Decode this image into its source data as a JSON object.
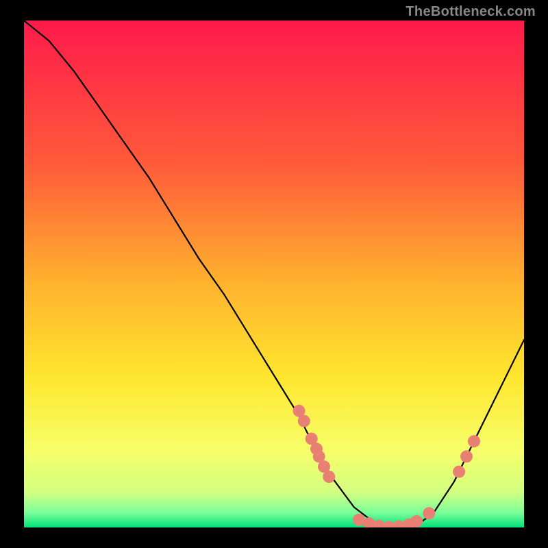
{
  "watermark": "TheBottleneck.com",
  "chart_data": {
    "type": "line",
    "title": "",
    "xlabel": "",
    "ylabel": "",
    "xlim": [
      0,
      100
    ],
    "ylim": [
      0,
      100
    ],
    "grid": false,
    "legend": false,
    "gradient_colors": {
      "top": "#ff1a4b",
      "mid_upper": "#ff7a2e",
      "mid": "#ffe52e",
      "mid_lower": "#f6ff6a",
      "bottom_band": "#a8ff8a",
      "bottom": "#00e27a"
    },
    "curve": {
      "name": "bottleneck-curve",
      "x": [
        0,
        5,
        10,
        15,
        20,
        25,
        30,
        35,
        40,
        45,
        50,
        55,
        58,
        60,
        63,
        66,
        70,
        74,
        78,
        82,
        86,
        90,
        94,
        98,
        100
      ],
      "y": [
        100,
        96,
        90,
        83,
        76,
        69,
        61,
        53,
        46,
        38,
        30,
        22,
        16,
        12,
        8,
        4,
        1,
        0,
        0,
        3,
        9,
        17,
        25,
        33,
        37
      ]
    },
    "markers": {
      "note": "salmon circular markers along the curve",
      "color": "#e98074",
      "radius_px": 9,
      "points": [
        {
          "x": 55.0,
          "y": 23.0
        },
        {
          "x": 56.0,
          "y": 21.0
        },
        {
          "x": 57.5,
          "y": 17.5
        },
        {
          "x": 58.5,
          "y": 15.5
        },
        {
          "x": 59.0,
          "y": 14.0
        },
        {
          "x": 60.0,
          "y": 12.0
        },
        {
          "x": 61.0,
          "y": 10.0
        },
        {
          "x": 67.0,
          "y": 1.5
        },
        {
          "x": 69.0,
          "y": 0.8
        },
        {
          "x": 71.0,
          "y": 0.3
        },
        {
          "x": 73.0,
          "y": 0.1
        },
        {
          "x": 75.0,
          "y": 0.2
        },
        {
          "x": 77.0,
          "y": 0.6
        },
        {
          "x": 78.5,
          "y": 1.2
        },
        {
          "x": 81.0,
          "y": 2.8
        },
        {
          "x": 87.0,
          "y": 11.0
        },
        {
          "x": 88.5,
          "y": 14.0
        },
        {
          "x": 90.0,
          "y": 17.0
        }
      ]
    }
  }
}
